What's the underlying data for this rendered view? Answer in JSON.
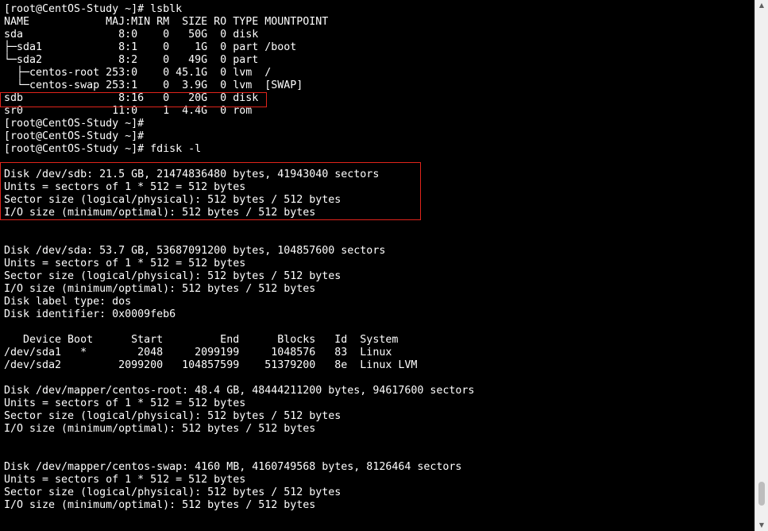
{
  "colors": {
    "background": "#000000",
    "text": "#ffffff",
    "highlight": "#e0241b"
  },
  "terminal": {
    "lines": [
      "[root@CentOS-Study ~]# lsblk",
      "NAME            MAJ:MIN RM  SIZE RO TYPE MOUNTPOINT",
      "sda               8:0    0   50G  0 disk",
      "├─sda1            8:1    0    1G  0 part /boot",
      "└─sda2            8:2    0   49G  0 part",
      "  ├─centos-root 253:0    0 45.1G  0 lvm  /",
      "  └─centos-swap 253:1    0  3.9G  0 lvm  [SWAP]",
      "sdb               8:16   0   20G  0 disk",
      "sr0              11:0    1  4.4G  0 rom",
      "[root@CentOS-Study ~]#",
      "[root@CentOS-Study ~]#",
      "[root@CentOS-Study ~]# fdisk -l",
      "",
      "Disk /dev/sdb: 21.5 GB, 21474836480 bytes, 41943040 sectors",
      "Units = sectors of 1 * 512 = 512 bytes",
      "Sector size (logical/physical): 512 bytes / 512 bytes",
      "I/O size (minimum/optimal): 512 bytes / 512 bytes",
      "",
      "",
      "Disk /dev/sda: 53.7 GB, 53687091200 bytes, 104857600 sectors",
      "Units = sectors of 1 * 512 = 512 bytes",
      "Sector size (logical/physical): 512 bytes / 512 bytes",
      "I/O size (minimum/optimal): 512 bytes / 512 bytes",
      "Disk label type: dos",
      "Disk identifier: 0x0009feb6",
      "",
      "   Device Boot      Start         End      Blocks   Id  System",
      "/dev/sda1   *        2048     2099199     1048576   83  Linux",
      "/dev/sda2         2099200   104857599    51379200   8e  Linux LVM",
      "",
      "Disk /dev/mapper/centos-root: 48.4 GB, 48444211200 bytes, 94617600 sectors",
      "Units = sectors of 1 * 512 = 512 bytes",
      "Sector size (logical/physical): 512 bytes / 512 bytes",
      "I/O size (minimum/optimal): 512 bytes / 512 bytes",
      "",
      "",
      "Disk /dev/mapper/centos-swap: 4160 MB, 4160749568 bytes, 8126464 sectors",
      "Units = sectors of 1 * 512 = 512 bytes",
      "Sector size (logical/physical): 512 bytes / 512 bytes",
      "I/O size (minimum/optimal): 512 bytes / 512 bytes"
    ]
  },
  "scrollbar": {
    "position": 0.97
  }
}
